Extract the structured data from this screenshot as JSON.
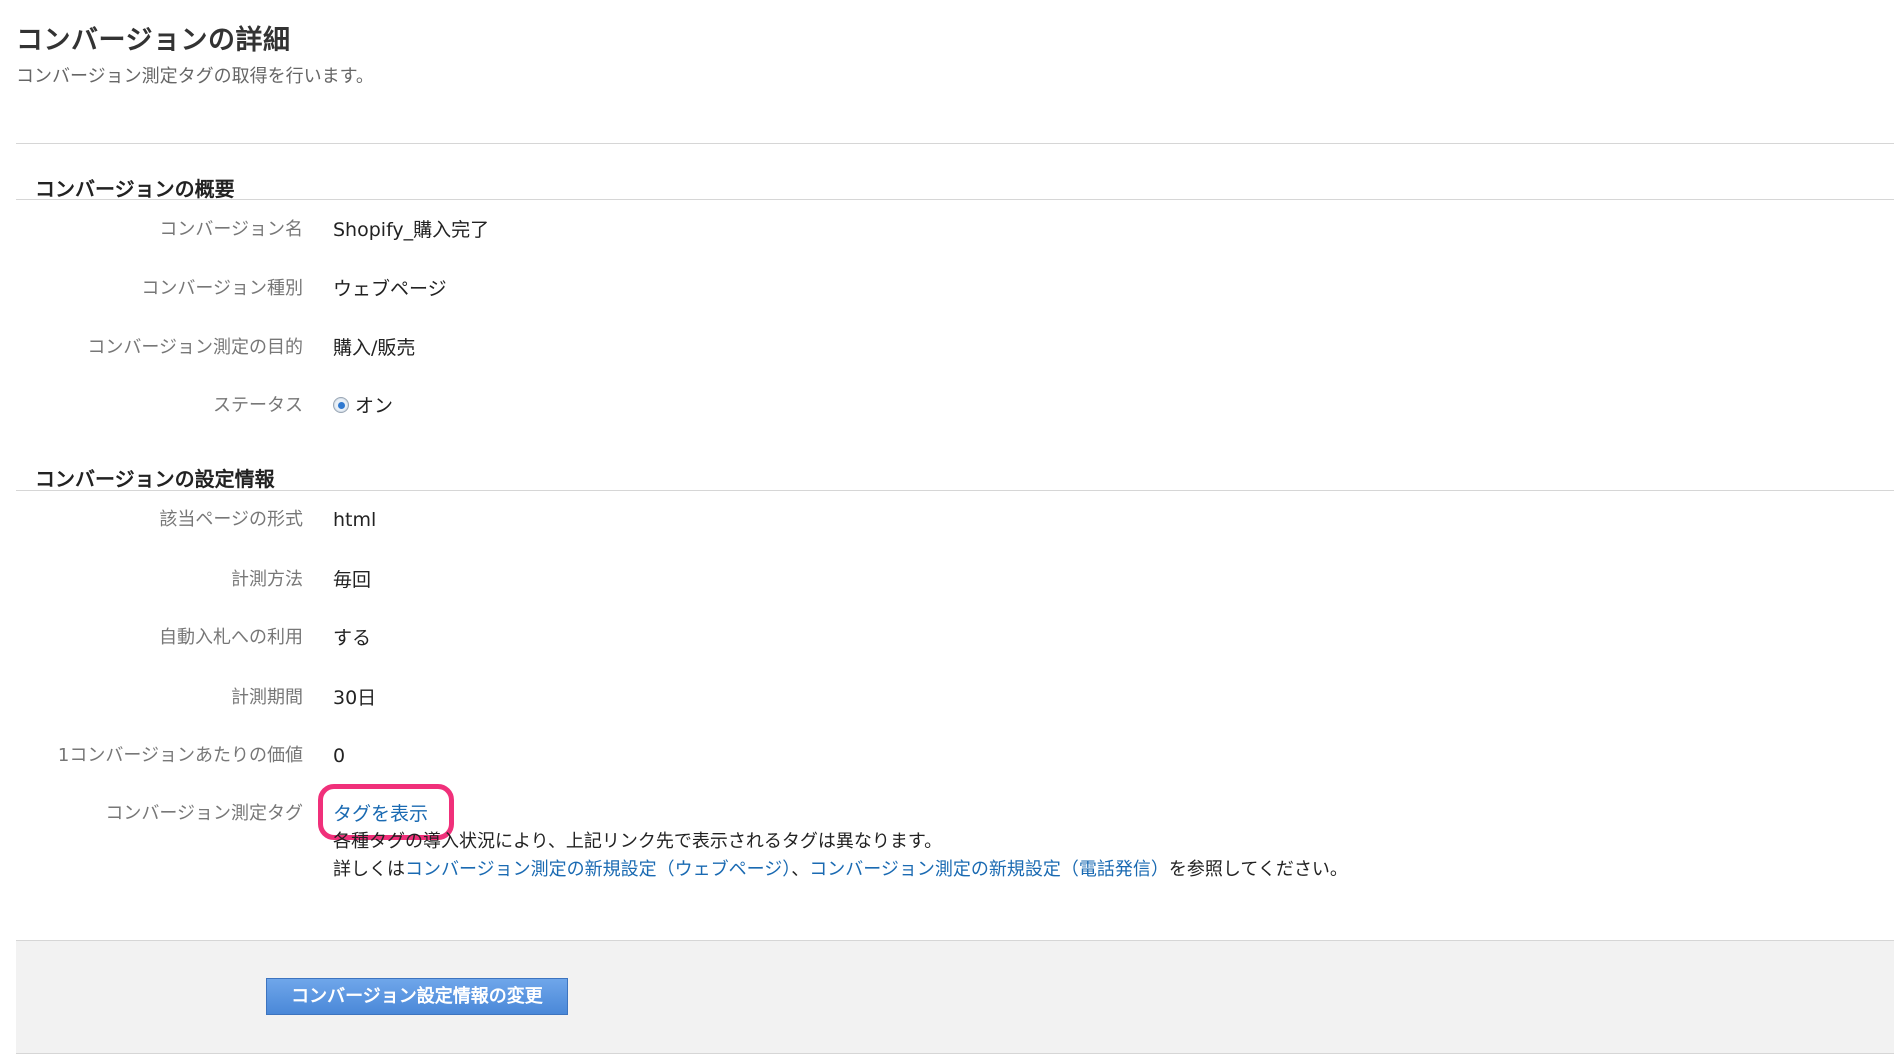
{
  "header": {
    "title": "コンバージョンの詳細",
    "subtitle": "コンバージョン測定タグの取得を行います。"
  },
  "overview": {
    "heading": "コンバージョンの概要",
    "rows": [
      {
        "label": "コンバージョン名",
        "value": "Shopify_購入完了"
      },
      {
        "label": "コンバージョン種別",
        "value": "ウェブページ"
      },
      {
        "label": "コンバージョン測定の目的",
        "value": "購入/販売"
      },
      {
        "label": "ステータス",
        "value": "オン"
      }
    ]
  },
  "settings": {
    "heading": "コンバージョンの設定情報",
    "rows": [
      {
        "label": "該当ページの形式",
        "value": "html"
      },
      {
        "label": "計測方法",
        "value": "毎回"
      },
      {
        "label": "自動入札への利用",
        "value": "する"
      },
      {
        "label": "計測期間",
        "value": "30日"
      },
      {
        "label": "1コンバージョンあたりの価値",
        "value": "0"
      },
      {
        "label": "コンバージョン測定タグ",
        "value": "タグを表示"
      }
    ],
    "note_line1": "各種タグの導入状況により、上記リンク先で表示されるタグは異なります。",
    "note_line2_prefix": "詳しくは",
    "note_link1": "コンバージョン測定の新規設定（ウェブページ）",
    "note_separator": "、",
    "note_link2": "コンバージョン測定の新規設定（電話発信）",
    "note_line2_suffix": "を参照してください。"
  },
  "footer": {
    "button_label": "コンバージョン設定情報の変更"
  },
  "colors": {
    "link": "#1a6ab2",
    "highlight": "#f0307a",
    "button": "#4a88d8"
  }
}
